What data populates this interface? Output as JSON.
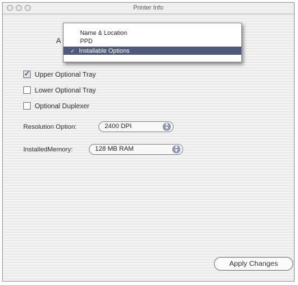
{
  "window": {
    "title": "Printer Info",
    "accent_color": "#4f5a78"
  },
  "popup_menu": {
    "backdrop_label": "A",
    "items": [
      {
        "label": "Name & Location",
        "selected": false
      },
      {
        "label": "PPD",
        "selected": false
      },
      {
        "label": "Installable Options",
        "selected": true
      }
    ],
    "check_icon": "checkmark-icon"
  },
  "options": {
    "upper_tray": {
      "label": "Upper Optional Tray",
      "checked": true
    },
    "lower_tray": {
      "label": "Lower Optional Tray",
      "checked": false
    },
    "duplexer": {
      "label": "Optional Duplexer",
      "checked": false
    }
  },
  "resolution": {
    "label": "Resolution Option:",
    "value": "2400 DPI"
  },
  "memory": {
    "label": "InstalledMemory:",
    "value": "128 MB RAM"
  },
  "apply_button": {
    "label": "Apply Changes"
  }
}
